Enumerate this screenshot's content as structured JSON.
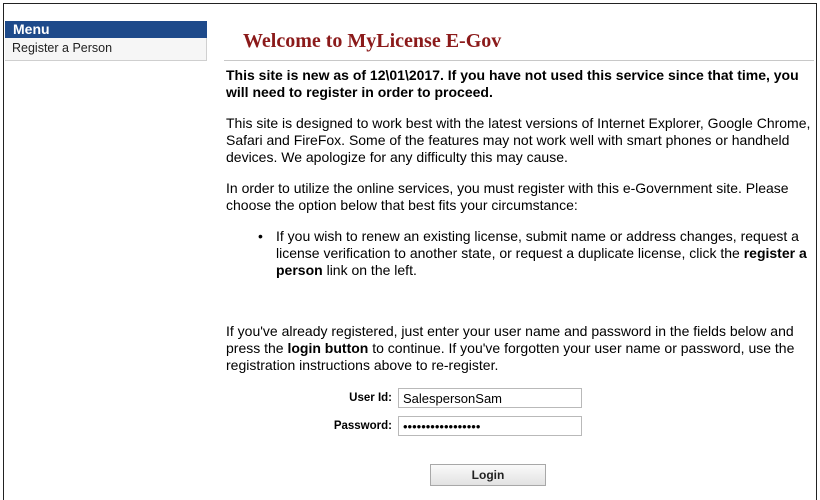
{
  "sidebar": {
    "header": "Menu",
    "items": [
      {
        "label": "Register a Person"
      }
    ]
  },
  "main": {
    "title": "Welcome to MyLicense E-Gov",
    "notice": "This site is new as of 12\\01\\2017. If you have not used this service since that time, you will need to register in order to proceed.",
    "browser_note": "This site is designed to work best with the latest versions of Internet Explorer, Google Chrome, Safari and FireFox. Some of the features may not work well with smart phones or handheld devices. We apologize for any difficulty this may cause.",
    "register_intro": "In order to utilize the online services, you must register with this e-Government site. Please choose the option below that best fits your circumstance:",
    "bullet": {
      "text_before": "If you wish to renew an existing license, submit name or address changes, request a license verification to another state, or request a duplicate license, click the ",
      "bold": "register a person",
      "text_after": " link on the left."
    },
    "login_intro": {
      "text_before": "If you've already registered, just enter your user name and password in the fields below and press the ",
      "bold": "login button",
      "text_after": " to continue. If you've forgotten your user name or password, use the registration instructions above to re-register."
    }
  },
  "login": {
    "user_label": "User Id:",
    "user_value": "SalespersonSam",
    "password_label": "Password:",
    "password_value": "salespersonpass!!",
    "button_label": "Login"
  }
}
